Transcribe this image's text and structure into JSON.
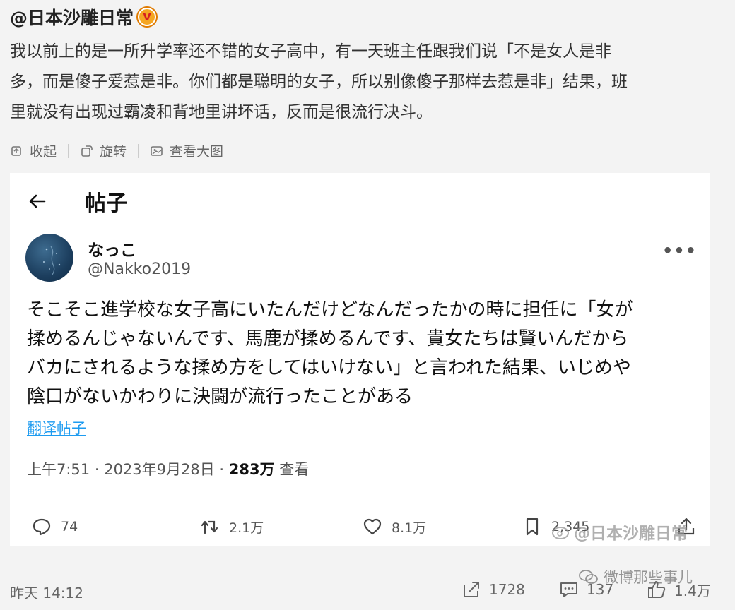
{
  "weibo": {
    "account": "@日本沙雕日常",
    "verified_mark": "V",
    "post_lines": [
      "我以前上的是一所升学率还不错的女子高中，有一天班主任跟我们说「不是女人是非",
      "多，而是傻子爱惹是非。你们都是聪明的女子，所以别像傻子那样去惹是非」结果，班",
      "里就没有出现过霸凌和背地里讲坏话，反而是很流行决斗。"
    ],
    "actions": {
      "collapse": "收起",
      "rotate": "旋转",
      "view_large": "查看大图"
    }
  },
  "embedded_post": {
    "header_title": "帖子",
    "user": {
      "name": "なっこ",
      "handle": "@Nakko2019"
    },
    "text_lines": [
      "そこそこ進学校な女子高にいたんだけどなんだったかの時に担任に「女が",
      "揉めるんじゃないんです、馬鹿が揉めるんです、貴女たちは賢いんだから",
      "バカにされるような揉め方をしてはいけない」と言われた結果、いじめや",
      "陰口がないかわりに決闘が流行ったことがある"
    ],
    "translate_link": "翻译帖子",
    "meta": {
      "time": "上午7:51",
      "date": "2023年9月28日",
      "views": "283万",
      "views_label": "查看",
      "separator": " · "
    },
    "stats": {
      "replies": "74",
      "reposts": "2.1万",
      "likes": "8.1万",
      "bookmarks": "2,345"
    }
  },
  "watermarks": {
    "inner": "@日本沙雕日常",
    "outer": "微博那些事儿"
  },
  "footer": {
    "time": "昨天 14:12",
    "shares": "1728",
    "comments": "137",
    "likes": "1.4万"
  }
}
